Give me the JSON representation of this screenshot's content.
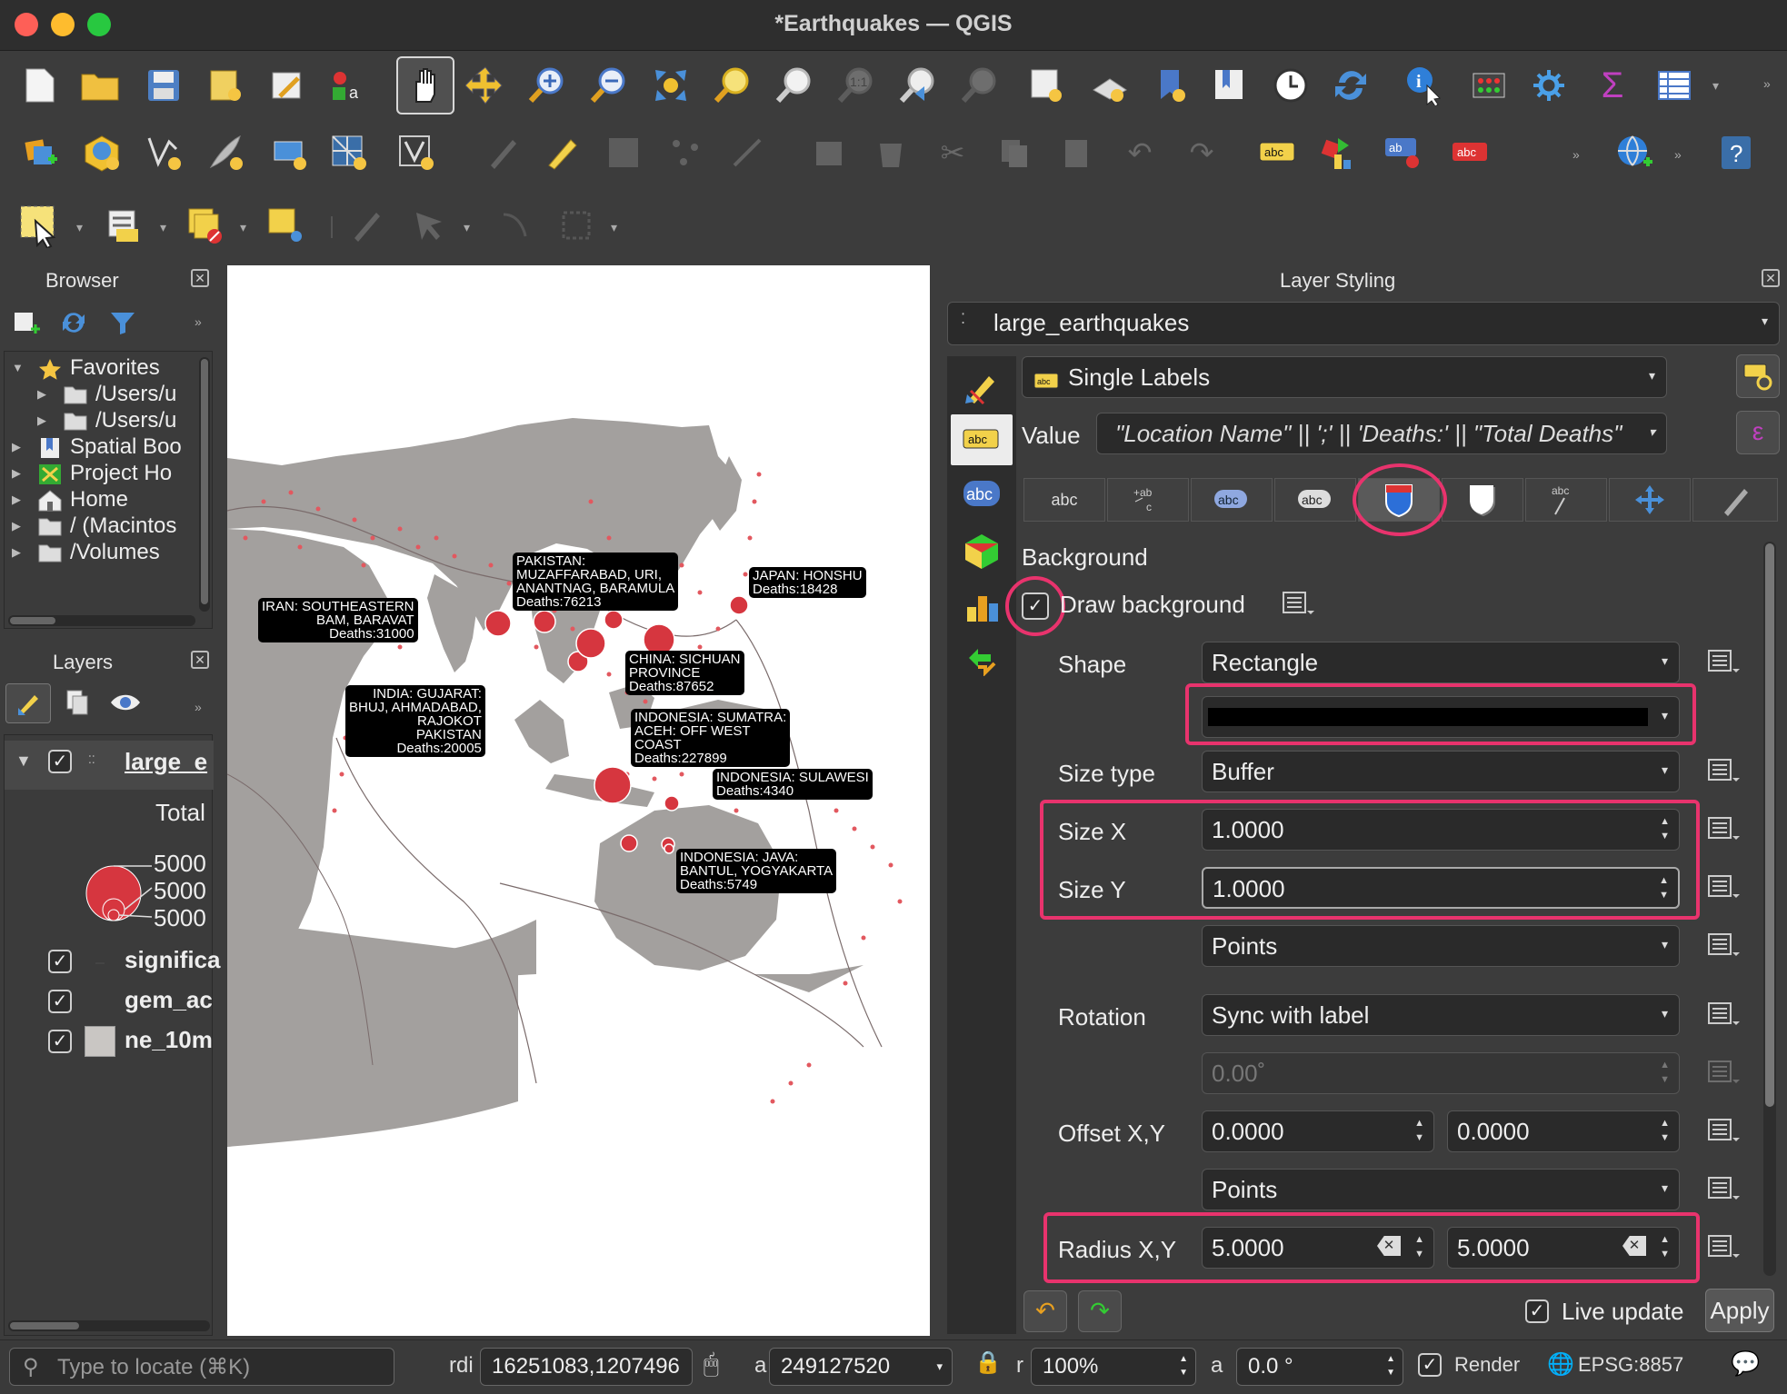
{
  "window": {
    "title": "*Earthquakes — QGIS"
  },
  "browser": {
    "title": "Browser",
    "items": [
      {
        "label": "Favorites",
        "icon": "star-icon"
      },
      {
        "label": "/Users/u",
        "icon": "folder-icon"
      },
      {
        "label": "/Users/u",
        "icon": "folder-icon"
      },
      {
        "label": "Spatial Boo",
        "icon": "bookmark-icon"
      },
      {
        "label": "Project Ho",
        "icon": "project-icon"
      },
      {
        "label": "Home",
        "icon": "home-icon"
      },
      {
        "label": "/ (Macintos",
        "icon": "folder-icon"
      },
      {
        "label": "/Volumes",
        "icon": "folder-icon"
      }
    ]
  },
  "layers": {
    "title": "Layers",
    "active_layer": "large_e",
    "legend_title": "Total",
    "legend_values": [
      "5000",
      "5000",
      "5000"
    ],
    "items": [
      {
        "label": "significa",
        "checked": true
      },
      {
        "label": "gem_ac",
        "checked": true
      },
      {
        "label": "ne_10m",
        "checked": true
      }
    ]
  },
  "map": {
    "labels": [
      {
        "id": "iran",
        "text": [
          "IRAN:  SOUTHEASTERN",
          "BAM, BARAVAT",
          "Deaths:31000"
        ]
      },
      {
        "id": "pakistan",
        "text": [
          "PAKISTAN:",
          "MUZAFFARABAD, URI,",
          "ANANTNAG, BARAMULA",
          "Deaths:76213"
        ]
      },
      {
        "id": "japan",
        "text": [
          "JAPAN:  HONSHU",
          "Deaths:18428"
        ]
      },
      {
        "id": "china",
        "text": [
          "CHINA:  SICHUAN",
          "PROVINCE",
          "Deaths:87652"
        ]
      },
      {
        "id": "india",
        "text": [
          "INDIA:  GUJARAT:",
          "BHUJ, AHMADABAD,",
          "RAJOKOT",
          "PAKISTAN",
          "Deaths:20005"
        ]
      },
      {
        "id": "sumatra",
        "text": [
          "INDONESIA:  SUMATRA:",
          " ACEH:  OFF WEST",
          "COAST",
          "Deaths:227899"
        ]
      },
      {
        "id": "sulawesi",
        "text": [
          "INDONESIA:  SULAWESI",
          "Deaths:4340"
        ]
      },
      {
        "id": "java",
        "text": [
          "INDONESIA:  JAVA:",
          "BANTUL, YOGYAKARTA",
          "Deaths:5749"
        ]
      }
    ]
  },
  "styling": {
    "title": "Layer Styling",
    "layer": "large_earthquakes",
    "mode": "Single Labels",
    "value_label": "Value",
    "value_expr": "\"Location Name\" || ';' || 'Deaths:' || \"Total Deaths\"",
    "tabs": [
      "abc",
      "+ab c",
      "abc",
      "abc",
      "background",
      "shadow",
      "abc",
      "placement",
      "rendering"
    ],
    "section": "Background",
    "draw_background": "Draw background",
    "shape_label": "Shape",
    "shape_value": "Rectangle",
    "fill_color": "#000000",
    "size_type_label": "Size type",
    "size_type_value": "Buffer",
    "size_x_label": "Size X",
    "size_x_value": "1.0000",
    "size_y_label": "Size Y",
    "size_y_value": "1.0000",
    "size_units": "Points",
    "rotation_label": "Rotation",
    "rotation_value": "Sync with label",
    "rotation_angle": "0.00˚",
    "offset_label": "Offset X,Y",
    "offset_x": "0.0000",
    "offset_y": "0.0000",
    "offset_units": "Points",
    "radius_label": "Radius X,Y",
    "radius_x": "5.0000",
    "radius_y": "5.0000",
    "live_update": "Live update",
    "apply": "Apply"
  },
  "status": {
    "locate_placeholder": "Type to locate (⌘K)",
    "coord_label": "rdi",
    "coordinate": "16251083,1207496",
    "scale_label": "a",
    "scale": "249127520",
    "mag_label": "r",
    "magnifier": "100%",
    "rot_label": "a",
    "rotation": "0.0 °",
    "render": "Render",
    "crs": "EPSG:8857"
  },
  "colors": {
    "accent": "#e8336d",
    "quake": "#d6363f",
    "land": "#a3a09e"
  }
}
